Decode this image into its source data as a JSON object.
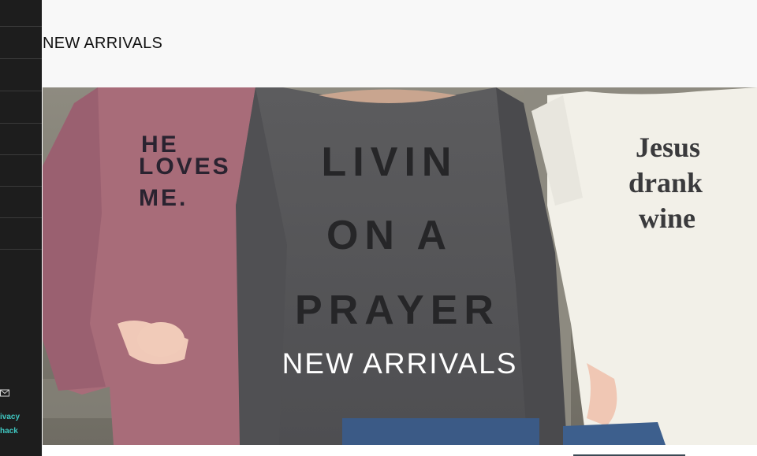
{
  "page": {
    "title": "NEW ARRIVALS"
  },
  "banner": {
    "caption": "NEW ARRIVALS",
    "shirt_left": [
      "HE",
      "LOVES",
      "ME."
    ],
    "shirt_center": [
      "LIVIN",
      "ON A",
      "PRAYER"
    ],
    "shirt_right": [
      "Jesus",
      "drank",
      "wine"
    ]
  },
  "sidebar": {
    "footer_links": [
      "ivacy",
      "hack"
    ],
    "icons": [
      "mail-icon"
    ]
  },
  "colors": {
    "sidebar_bg": "#1d1d1d",
    "link": "#3fc7c1"
  }
}
